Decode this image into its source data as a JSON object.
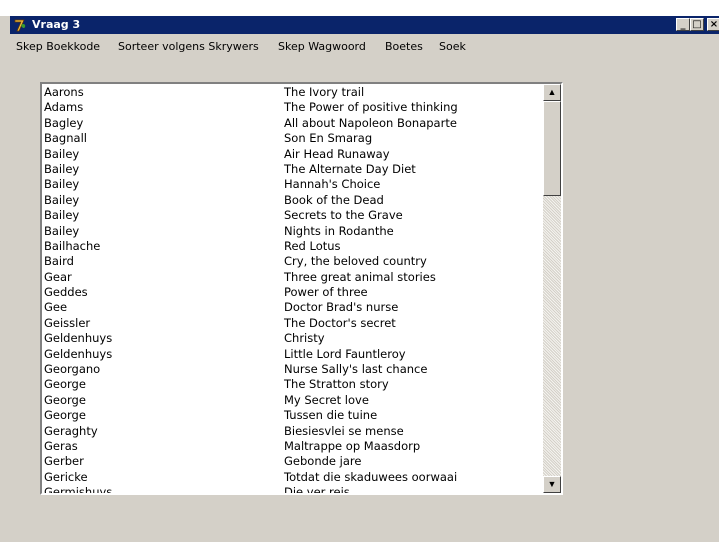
{
  "window": {
    "title": "Vraag 3",
    "minimize_glyph": "_",
    "maximize_glyph": "□",
    "close_glyph": "×",
    "icon": "delphi-app-icon"
  },
  "menu": [
    {
      "label": "Skep Boekkode"
    },
    {
      "label": "Sorteer volgens Skrywers"
    },
    {
      "label": "Skep Wagwoord"
    },
    {
      "label": "Boetes"
    },
    {
      "label": "Soek"
    }
  ],
  "list": {
    "rows": [
      {
        "author": "Aarons",
        "title": "The Ivory trail"
      },
      {
        "author": "Adams",
        "title": "The Power of positive thinking"
      },
      {
        "author": "Bagley",
        "title": "All about Napoleon Bonaparte"
      },
      {
        "author": "Bagnall",
        "title": "Son En Smarag"
      },
      {
        "author": "Bailey",
        "title": "Air Head Runaway"
      },
      {
        "author": "Bailey",
        "title": "The Alternate Day Diet"
      },
      {
        "author": "Bailey",
        "title": "Hannah's Choice"
      },
      {
        "author": "Bailey",
        "title": "Book of the Dead"
      },
      {
        "author": "Bailey",
        "title": "Secrets to the Grave"
      },
      {
        "author": "Bailey",
        "title": "Nights in Rodanthe"
      },
      {
        "author": "Bailhache",
        "title": "Red Lotus"
      },
      {
        "author": "Baird",
        "title": "Cry, the beloved country"
      },
      {
        "author": "Gear",
        "title": "Three great animal stories"
      },
      {
        "author": "Geddes",
        "title": "Power of three"
      },
      {
        "author": "Gee",
        "title": "Doctor Brad's nurse"
      },
      {
        "author": "Geissler",
        "title": "The Doctor's secret"
      },
      {
        "author": "Geldenhuys",
        "title": "Christy"
      },
      {
        "author": "Geldenhuys",
        "title": "Little Lord Fauntleroy"
      },
      {
        "author": "Georgano",
        "title": "Nurse Sally's last chance"
      },
      {
        "author": "George",
        "title": "The Stratton story"
      },
      {
        "author": "George",
        "title": "My Secret love"
      },
      {
        "author": "George",
        "title": "Tussen die tuine"
      },
      {
        "author": "Geraghty",
        "title": "Biesiesvlei se mense"
      },
      {
        "author": "Geras",
        "title": "Maltrappe op Maasdorp"
      },
      {
        "author": "Gerber",
        "title": "Gebonde jare"
      },
      {
        "author": "Gericke",
        "title": "Totdat die skaduwees oorwaai"
      },
      {
        "author": "Germishuys",
        "title": "Die ver reis"
      }
    ]
  },
  "scrollbar": {
    "up_glyph": "▲",
    "down_glyph": "▼"
  },
  "colors": {
    "title_bar": "#0a246a",
    "face": "#d4d0c8"
  }
}
